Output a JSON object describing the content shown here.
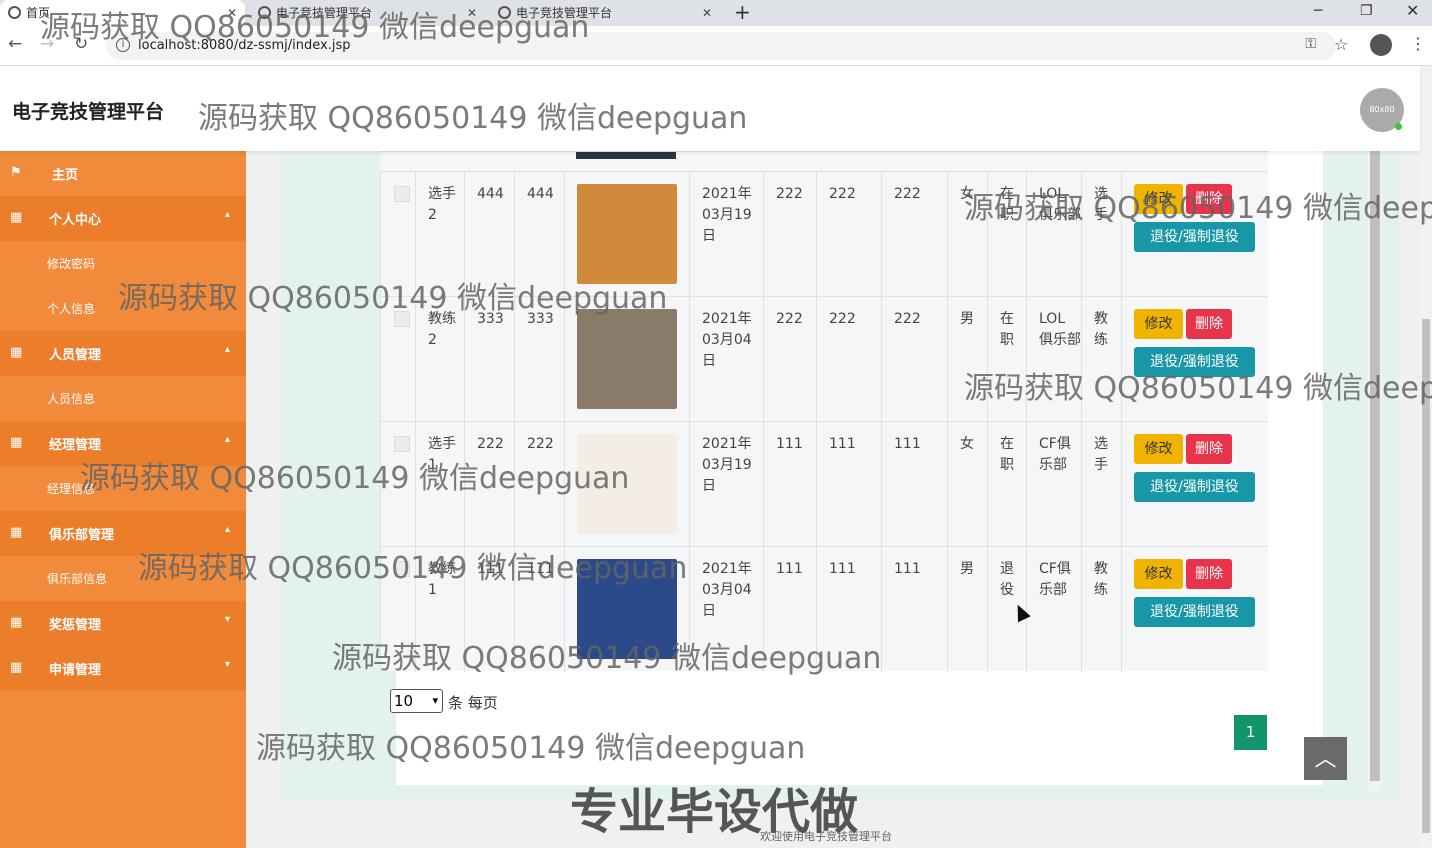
{
  "browser": {
    "tabs": [
      "首页",
      "电子竞技管理平台",
      "电子竞技管理平台"
    ],
    "url": "localhost:8080/dz-ssmj/index.jsp"
  },
  "header": {
    "title": "电子竞技管理平台",
    "avatar_text": "80x80"
  },
  "sidebar": {
    "home": "主页",
    "groups": [
      {
        "label": "个人中心",
        "subs": [
          "修改密码",
          "个人信息"
        ]
      },
      {
        "label": "人员管理",
        "subs": [
          "人员信息"
        ]
      },
      {
        "label": "经理管理",
        "subs": [
          "经理信息"
        ]
      },
      {
        "label": "俱乐部管理",
        "subs": [
          "俱乐部信息"
        ]
      },
      {
        "label": "奖惩管理",
        "subs": []
      },
      {
        "label": "申请管理",
        "subs": []
      }
    ]
  },
  "table": {
    "rows": [
      {
        "c1": "选手2",
        "c2": "444",
        "c3": "444",
        "date": "2021年03月19日",
        "c5": "222",
        "c6": "222",
        "c7": "222",
        "sex": "女",
        "status": "在职",
        "club": "LOL俱乐部",
        "role": "选手"
      },
      {
        "c1": "教练2",
        "c2": "333",
        "c3": "333",
        "date": "2021年03月04日",
        "c5": "222",
        "c6": "222",
        "c7": "222",
        "sex": "男",
        "status": "在职",
        "club": "LOL俱乐部",
        "role": "教练"
      },
      {
        "c1": "选手1",
        "c2": "222",
        "c3": "222",
        "date": "2021年03月19日",
        "c5": "111",
        "c6": "111",
        "c7": "111",
        "sex": "女",
        "status": "在职",
        "club": "CF俱乐部",
        "role": "选手"
      },
      {
        "c1": "教练1",
        "c2": "111",
        "c3": "111",
        "date": "2021年03月04日",
        "c5": "111",
        "c6": "111",
        "c7": "111",
        "sex": "男",
        "status": "退役",
        "club": "CF俱乐部",
        "role": "教练"
      }
    ],
    "btn_edit": "修改",
    "btn_delete": "删除",
    "btn_retire": "退役/强制退役"
  },
  "pagination": {
    "page_size": "10",
    "per_page_label": "条 每页",
    "current_page": "1"
  },
  "footer": {
    "text": "欢迎使用电子竞技管理平台"
  },
  "watermark": {
    "text": "源码获取 QQ86050149 微信deepguan",
    "promo": "专业毕设代做"
  }
}
